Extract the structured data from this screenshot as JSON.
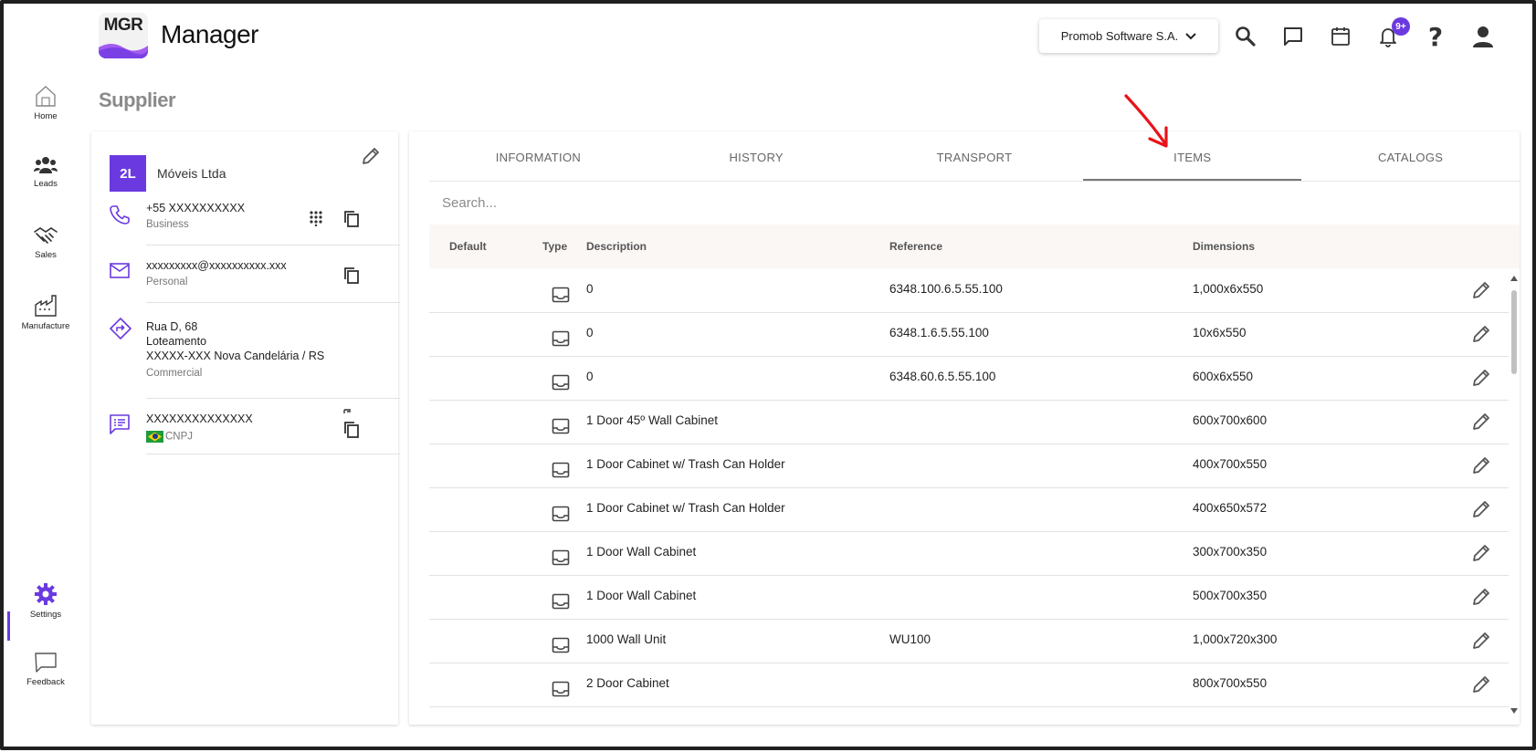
{
  "app": {
    "logo_text": "MGR",
    "title": "Manager"
  },
  "header": {
    "company_selector": "Promob Software S.A.",
    "notification_badge": "9+",
    "icons": [
      "search-icon",
      "chat-icon",
      "calendar-icon",
      "bell-icon",
      "help-icon",
      "user-icon"
    ]
  },
  "sidebar": {
    "items": [
      {
        "label": "Home",
        "icon": "home-icon"
      },
      {
        "label": "Leads",
        "icon": "people-icon"
      },
      {
        "label": "Sales",
        "icon": "handshake-icon"
      },
      {
        "label": "Manufacture",
        "icon": "factory-icon"
      },
      {
        "label": "Settings",
        "icon": "gear-icon",
        "active": true
      },
      {
        "label": "Feedback",
        "icon": "feedback-icon"
      }
    ]
  },
  "page": {
    "title": "Supplier"
  },
  "supplier": {
    "avatar": "2L",
    "name": "Móveis Ltda",
    "phone": {
      "value": "+55 XXXXXXXXXX",
      "label": "Business"
    },
    "email": {
      "value": "xxxxxxxxx@xxxxxxxxxx.xxx",
      "label": "Personal"
    },
    "address": {
      "line1": "Rua D, 68",
      "line2": "Loteamento",
      "line3": "XXXXX-XXX Nova Candelária / RS",
      "label": "Commercial"
    },
    "document": {
      "value": "XXXXXXXXXXXXXX",
      "label": "CNPJ"
    }
  },
  "tabs": [
    "INFORMATION",
    "HISTORY",
    "TRANSPORT",
    "ITEMS",
    "CATALOGS"
  ],
  "active_tab": "ITEMS",
  "search": {
    "placeholder": "Search..."
  },
  "table": {
    "columns": [
      "Default",
      "Type",
      "Description",
      "Reference",
      "Dimensions"
    ],
    "rows": [
      {
        "description": "0",
        "reference": "6348.100.6.5.55.100",
        "dimensions": "1,000x6x550"
      },
      {
        "description": "0",
        "reference": "6348.1.6.5.55.100",
        "dimensions": "10x6x550"
      },
      {
        "description": "0",
        "reference": "6348.60.6.5.55.100",
        "dimensions": "600x6x550"
      },
      {
        "description": "1 Door 45º Wall Cabinet",
        "reference": "",
        "dimensions": "600x700x600"
      },
      {
        "description": "1 Door Cabinet w/ Trash Can Holder",
        "reference": "",
        "dimensions": "400x700x550"
      },
      {
        "description": "1 Door Cabinet w/ Trash Can Holder",
        "reference": "",
        "dimensions": "400x650x572"
      },
      {
        "description": "1 Door Wall Cabinet",
        "reference": "",
        "dimensions": "300x700x350"
      },
      {
        "description": "1 Door Wall Cabinet",
        "reference": "",
        "dimensions": "500x700x350"
      },
      {
        "description": "1000 Wall Unit",
        "reference": "WU100",
        "dimensions": "1,000x720x300"
      },
      {
        "description": "2 Door Cabinet",
        "reference": "",
        "dimensions": "800x700x550"
      }
    ]
  },
  "colors": {
    "accent": "#6a3ae0",
    "annotation_arrow": "#e8121a"
  }
}
